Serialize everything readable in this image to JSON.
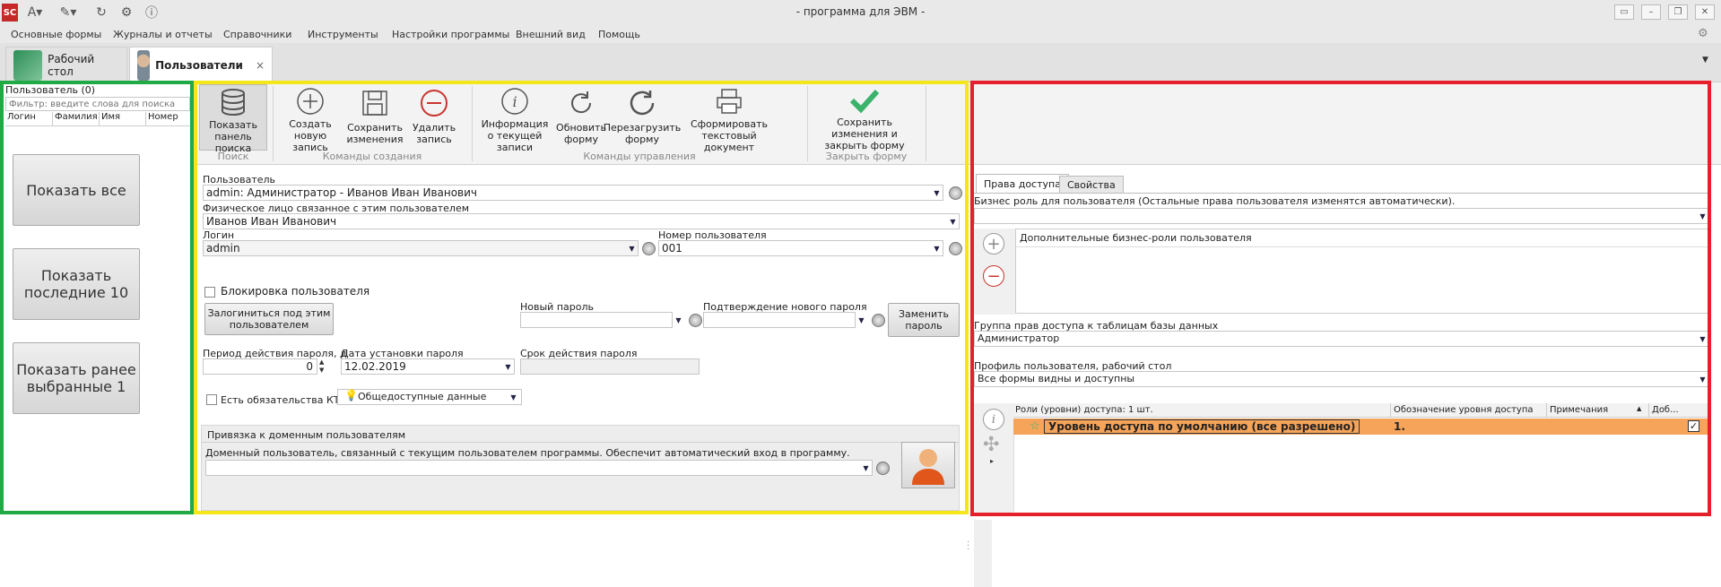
{
  "window": {
    "title": "- программа для ЭВМ -",
    "logo_text": "SC"
  },
  "menu": [
    "Основные формы",
    "Журналы и отчеты",
    "Справочники",
    "Инструменты",
    "Настройки программы",
    "Внешний вид",
    "Помощь"
  ],
  "tabs": [
    {
      "label": "Рабочий стол",
      "active": false
    },
    {
      "label": "Пользователи",
      "active": true,
      "close": "×"
    }
  ],
  "left_panel": {
    "header": "Пользователь (0)",
    "filter_placeholder": "Фильтр: введите слова для поиска",
    "columns": [
      "Логин",
      "Фамилия",
      "Имя",
      "Номер"
    ],
    "buttons": [
      "Показать все",
      "Показать последние 10",
      "Показать ранее выбранные 1"
    ]
  },
  "ribbon": {
    "groups": [
      {
        "label": "Поиск",
        "buttons": [
          "Показать панель поиска"
        ]
      },
      {
        "label": "Команды создания",
        "buttons": [
          "Создать новую запись",
          "Сохранить изменения",
          "Удалить запись"
        ]
      },
      {
        "label": "Команды управления",
        "buttons": [
          "Информация о текущей записи",
          "Обновить форму",
          "Перезагрузить форму",
          "Сформировать текстовый документ"
        ]
      },
      {
        "label": "Закрыть форму",
        "buttons": [
          "Сохранить изменения и закрыть форму"
        ]
      }
    ]
  },
  "form": {
    "user_label": "Пользователь",
    "user_value": "admin: Администратор - Иванов Иван Иванович",
    "person_label": "Физическое лицо связанное с этим пользователем",
    "person_value": "Иванов Иван Иванович",
    "login_label": "Логин",
    "login_value": "admin",
    "number_label": "Номер пользователя",
    "number_value": "001",
    "block_label": "Блокировка пользователя",
    "login_as_button": "Залогиниться под этим пользователем",
    "new_password_label": "Новый пароль",
    "confirm_password_label": "Подтверждение нового пароля",
    "change_password_button": "Заменить пароль",
    "period_label": "Период действия пароля, д",
    "period_value": "0",
    "set_date_label": "Дата установки пароля",
    "set_date_value": "12.02.2019",
    "expiry_label": "Срок действия пароля",
    "kt_label": "Есть обязательства КТ",
    "kt_select_value": "Общедоступные данные",
    "domain_group_label": "Привязка к доменным пользователям",
    "domain_label": "Доменный пользователь, связанный с текущим пользователем программы. Обеспечит автоматический вход в программу."
  },
  "right_panel": {
    "tabs": [
      "Права доступа",
      "Свойства"
    ],
    "business_role_label": "Бизнес роль для пользователя (Остальные права пользователя изменятся автоматически).",
    "extra_roles_header": "Дополнительные бизнес-роли пользователя",
    "access_group_label": "Группа прав доступа к таблицам базы данных",
    "access_group_value": "Администратор",
    "profile_label": "Профиль пользователя, рабочий стол",
    "profile_value": "Все формы видны и доступны",
    "grid_columns": [
      "Роли (уровни) доступа: 1 шт.",
      "Обозначение уровня доступа",
      "Примечания",
      "Доб..."
    ],
    "grid_rows": [
      {
        "role": "Уровень доступа по умолчанию (все разрешено)",
        "code": "1.",
        "checked": true
      }
    ]
  },
  "colors": {
    "highlight_green": "#1faa44",
    "highlight_yellow": "#f5e619",
    "highlight_red": "#e5202a",
    "row_highlight": "#f5a45a",
    "accent_green": "#3bb36b",
    "accent_red": "#c9342f"
  }
}
